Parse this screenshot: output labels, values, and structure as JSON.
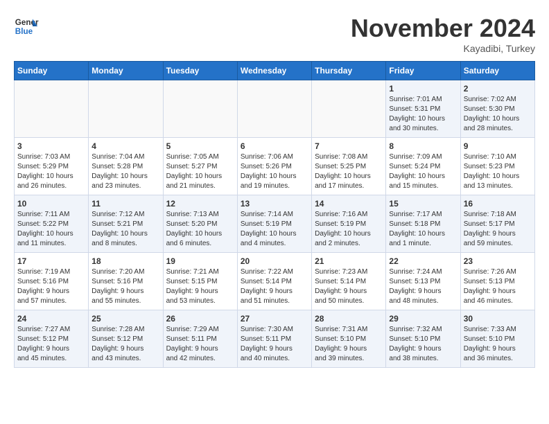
{
  "header": {
    "logo_line1": "General",
    "logo_line2": "Blue",
    "month_title": "November 2024",
    "location": "Kayadibi, Turkey"
  },
  "weekdays": [
    "Sunday",
    "Monday",
    "Tuesday",
    "Wednesday",
    "Thursday",
    "Friday",
    "Saturday"
  ],
  "weeks": [
    [
      {
        "day": "",
        "info": ""
      },
      {
        "day": "",
        "info": ""
      },
      {
        "day": "",
        "info": ""
      },
      {
        "day": "",
        "info": ""
      },
      {
        "day": "",
        "info": ""
      },
      {
        "day": "1",
        "info": "Sunrise: 7:01 AM\nSunset: 5:31 PM\nDaylight: 10 hours\nand 30 minutes."
      },
      {
        "day": "2",
        "info": "Sunrise: 7:02 AM\nSunset: 5:30 PM\nDaylight: 10 hours\nand 28 minutes."
      }
    ],
    [
      {
        "day": "3",
        "info": "Sunrise: 7:03 AM\nSunset: 5:29 PM\nDaylight: 10 hours\nand 26 minutes."
      },
      {
        "day": "4",
        "info": "Sunrise: 7:04 AM\nSunset: 5:28 PM\nDaylight: 10 hours\nand 23 minutes."
      },
      {
        "day": "5",
        "info": "Sunrise: 7:05 AM\nSunset: 5:27 PM\nDaylight: 10 hours\nand 21 minutes."
      },
      {
        "day": "6",
        "info": "Sunrise: 7:06 AM\nSunset: 5:26 PM\nDaylight: 10 hours\nand 19 minutes."
      },
      {
        "day": "7",
        "info": "Sunrise: 7:08 AM\nSunset: 5:25 PM\nDaylight: 10 hours\nand 17 minutes."
      },
      {
        "day": "8",
        "info": "Sunrise: 7:09 AM\nSunset: 5:24 PM\nDaylight: 10 hours\nand 15 minutes."
      },
      {
        "day": "9",
        "info": "Sunrise: 7:10 AM\nSunset: 5:23 PM\nDaylight: 10 hours\nand 13 minutes."
      }
    ],
    [
      {
        "day": "10",
        "info": "Sunrise: 7:11 AM\nSunset: 5:22 PM\nDaylight: 10 hours\nand 11 minutes."
      },
      {
        "day": "11",
        "info": "Sunrise: 7:12 AM\nSunset: 5:21 PM\nDaylight: 10 hours\nand 8 minutes."
      },
      {
        "day": "12",
        "info": "Sunrise: 7:13 AM\nSunset: 5:20 PM\nDaylight: 10 hours\nand 6 minutes."
      },
      {
        "day": "13",
        "info": "Sunrise: 7:14 AM\nSunset: 5:19 PM\nDaylight: 10 hours\nand 4 minutes."
      },
      {
        "day": "14",
        "info": "Sunrise: 7:16 AM\nSunset: 5:19 PM\nDaylight: 10 hours\nand 2 minutes."
      },
      {
        "day": "15",
        "info": "Sunrise: 7:17 AM\nSunset: 5:18 PM\nDaylight: 10 hours\nand 1 minute."
      },
      {
        "day": "16",
        "info": "Sunrise: 7:18 AM\nSunset: 5:17 PM\nDaylight: 9 hours\nand 59 minutes."
      }
    ],
    [
      {
        "day": "17",
        "info": "Sunrise: 7:19 AM\nSunset: 5:16 PM\nDaylight: 9 hours\nand 57 minutes."
      },
      {
        "day": "18",
        "info": "Sunrise: 7:20 AM\nSunset: 5:16 PM\nDaylight: 9 hours\nand 55 minutes."
      },
      {
        "day": "19",
        "info": "Sunrise: 7:21 AM\nSunset: 5:15 PM\nDaylight: 9 hours\nand 53 minutes."
      },
      {
        "day": "20",
        "info": "Sunrise: 7:22 AM\nSunset: 5:14 PM\nDaylight: 9 hours\nand 51 minutes."
      },
      {
        "day": "21",
        "info": "Sunrise: 7:23 AM\nSunset: 5:14 PM\nDaylight: 9 hours\nand 50 minutes."
      },
      {
        "day": "22",
        "info": "Sunrise: 7:24 AM\nSunset: 5:13 PM\nDaylight: 9 hours\nand 48 minutes."
      },
      {
        "day": "23",
        "info": "Sunrise: 7:26 AM\nSunset: 5:13 PM\nDaylight: 9 hours\nand 46 minutes."
      }
    ],
    [
      {
        "day": "24",
        "info": "Sunrise: 7:27 AM\nSunset: 5:12 PM\nDaylight: 9 hours\nand 45 minutes."
      },
      {
        "day": "25",
        "info": "Sunrise: 7:28 AM\nSunset: 5:12 PM\nDaylight: 9 hours\nand 43 minutes."
      },
      {
        "day": "26",
        "info": "Sunrise: 7:29 AM\nSunset: 5:11 PM\nDaylight: 9 hours\nand 42 minutes."
      },
      {
        "day": "27",
        "info": "Sunrise: 7:30 AM\nSunset: 5:11 PM\nDaylight: 9 hours\nand 40 minutes."
      },
      {
        "day": "28",
        "info": "Sunrise: 7:31 AM\nSunset: 5:10 PM\nDaylight: 9 hours\nand 39 minutes."
      },
      {
        "day": "29",
        "info": "Sunrise: 7:32 AM\nSunset: 5:10 PM\nDaylight: 9 hours\nand 38 minutes."
      },
      {
        "day": "30",
        "info": "Sunrise: 7:33 AM\nSunset: 5:10 PM\nDaylight: 9 hours\nand 36 minutes."
      }
    ]
  ]
}
